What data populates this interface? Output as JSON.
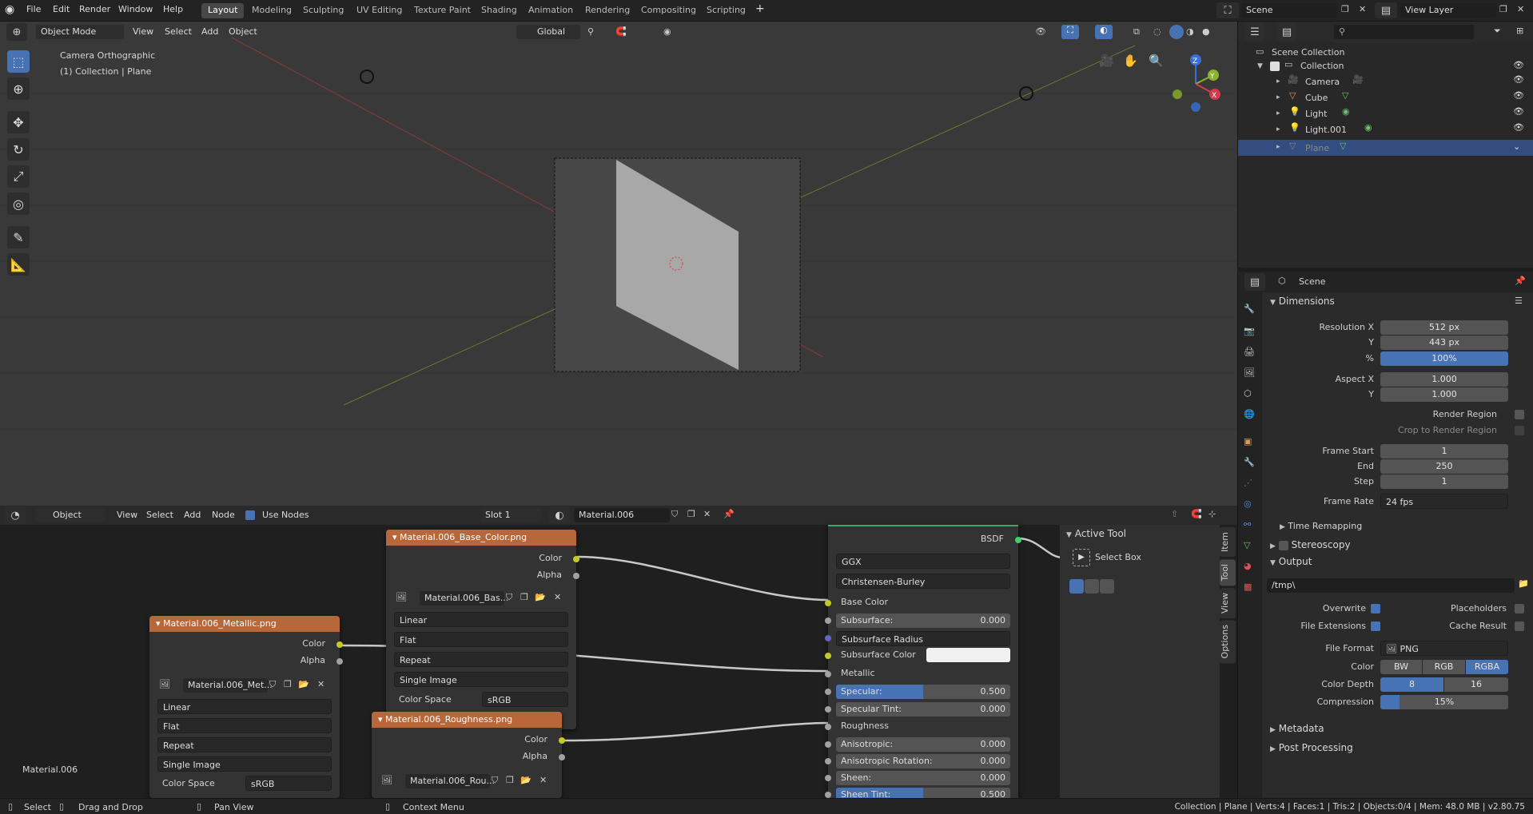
{
  "topbar": {
    "menus": [
      "File",
      "Edit",
      "Render",
      "Window",
      "Help"
    ],
    "workspaces": [
      "Layout",
      "Modeling",
      "Sculpting",
      "UV Editing",
      "Texture Paint",
      "Shading",
      "Animation",
      "Rendering",
      "Compositing",
      "Scripting"
    ],
    "add_tab": "+",
    "scene_name": "Scene",
    "view_layer": "View Layer"
  },
  "viewport": {
    "mode": "Object Mode",
    "menus": [
      "View",
      "Select",
      "Add",
      "Object"
    ],
    "transform_orientation": "Global",
    "camera_label": "Camera Orthographic",
    "collection_label": "(1) Collection | Plane",
    "gizmo": {
      "z": "Z",
      "y": "Y",
      "x": "X"
    }
  },
  "node_editor": {
    "editor_type": "Object",
    "menus": [
      "View",
      "Select",
      "Add",
      "Node"
    ],
    "use_nodes_label": "Use Nodes",
    "slot": "Slot 1",
    "material": "Material.006",
    "footer_label": "Material.006",
    "nodes": {
      "base_color": {
        "title": "Material.006_Base_Color.png",
        "out_color": "Color",
        "out_alpha": "Alpha",
        "image": "Material.006_Bas...",
        "interpolation": "Linear",
        "projection": "Flat",
        "extension": "Repeat",
        "source": "Single Image",
        "colorspace_label": "Color Space",
        "colorspace": "sRGB"
      },
      "metallic": {
        "title": "Material.006_Metallic.png",
        "out_color": "Color",
        "out_alpha": "Alpha",
        "image": "Material.006_Met...",
        "interpolation": "Linear",
        "projection": "Flat",
        "extension": "Repeat",
        "source": "Single Image",
        "colorspace_label": "Color Space",
        "colorspace": "sRGB"
      },
      "roughness": {
        "title": "Material.006_Roughness.png",
        "out_color": "Color",
        "out_alpha": "Alpha",
        "image": "Material.006_Rou..."
      },
      "bsdf": {
        "output": "BSDF",
        "distribution": "GGX",
        "subsurface_method": "Christensen-Burley",
        "base_color": "Base Color",
        "subsurface": "Subsurface:",
        "subsurface_val": "0.000",
        "subsurface_radius": "Subsurface Radius",
        "subsurface_color": "Subsurface Color",
        "metallic": "Metallic",
        "specular": "Specular:",
        "specular_val": "0.500",
        "specular_tint": "Specular Tint:",
        "specular_tint_val": "0.000",
        "roughness": "Roughness",
        "anisotropic": "Anisotropic:",
        "anisotropic_val": "0.000",
        "anisotropic_rotation": "Anisotropic Rotation:",
        "anisotropic_rotation_val": "0.000",
        "sheen": "Sheen:",
        "sheen_val": "0.000",
        "sheen_tint": "Sheen Tint:",
        "sheen_tint_val": "0.500"
      }
    },
    "sidebar": {
      "active_tool": "Active Tool",
      "select_box": "Select Box",
      "tabs": [
        "Item",
        "Tool",
        "View",
        "Options"
      ]
    }
  },
  "outliner": {
    "scene_collection": "Scene Collection",
    "collection": "Collection",
    "items": [
      "Camera",
      "Cube",
      "Light",
      "Light.001",
      "Plane"
    ]
  },
  "properties": {
    "context": "Scene",
    "dimensions": "Dimensions",
    "resolution_x_label": "Resolution X",
    "resolution_x": "512 px",
    "y_label": "Y",
    "resolution_y": "443 px",
    "percent_label": "%",
    "percent": "100%",
    "aspect_x_label": "Aspect X",
    "aspect_x": "1.000",
    "aspect_y": "1.000",
    "render_region": "Render Region",
    "crop_region": "Crop to Render Region",
    "frame_start_label": "Frame Start",
    "frame_start": "1",
    "end_label": "End",
    "frame_end": "250",
    "step_label": "Step",
    "frame_step": "1",
    "frame_rate_label": "Frame Rate",
    "frame_rate": "24 fps",
    "time_remapping": "Time Remapping",
    "stereoscopy": "Stereoscopy",
    "output": "Output",
    "output_path": "/tmp\\",
    "overwrite": "Overwrite",
    "placeholders": "Placeholders",
    "file_extensions": "File Extensions",
    "cache_result": "Cache Result",
    "file_format_label": "File Format",
    "file_format": "PNG",
    "color_label": "Color",
    "color_modes": [
      "BW",
      "RGB",
      "RGBA"
    ],
    "color_depth_label": "Color Depth",
    "color_depths": [
      "8",
      "16"
    ],
    "compression_label": "Compression",
    "compression": "15%",
    "compression_fraction": 0.15,
    "metadata": "Metadata",
    "post_processing": "Post Processing"
  },
  "statusbar": {
    "select": "Select",
    "drag": "Drag and Drop",
    "pan": "Pan View",
    "context": "Context Menu",
    "info": "Collection | Plane | Verts:4 | Faces:1 | Tris:2 | Objects:0/4 | Mem: 48.0 MB | v2.80.75"
  }
}
